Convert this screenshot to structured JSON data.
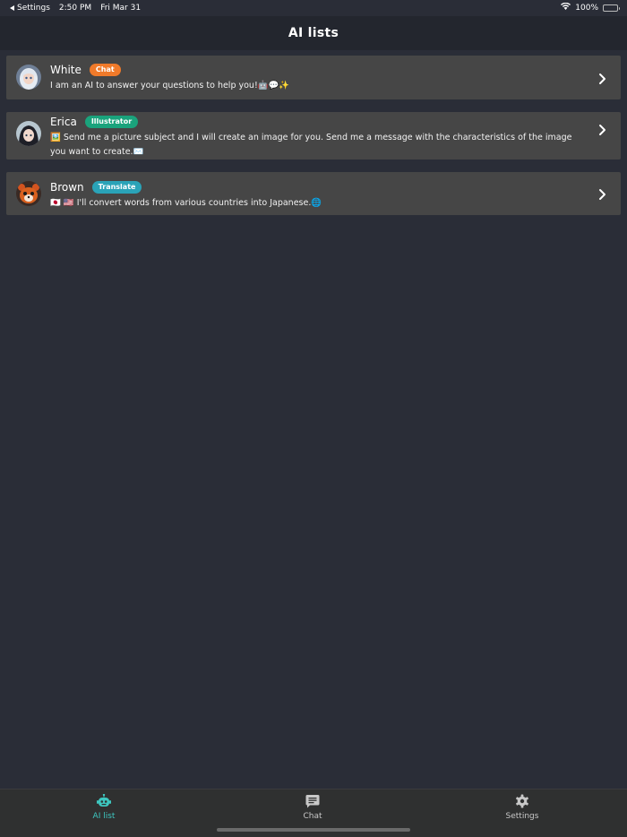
{
  "status_bar": {
    "back_label": "Settings",
    "time": "2:50 PM",
    "date": "Fri Mar 31",
    "battery": "100%"
  },
  "header": {
    "title": "AI lists"
  },
  "ai_list": [
    {
      "name": "White",
      "badge": "Chat",
      "badge_color": "#f07a2a",
      "description": "I am an AI to answer your questions to help you!🤖💬✨"
    },
    {
      "name": "Erica",
      "badge": "Illustrator",
      "badge_color": "#1aa37c",
      "description": "🖼️ Send me a picture subject and I will create an image for you. Send me a message with the characteristics of the image you want to create.✉️"
    },
    {
      "name": "Brown",
      "badge": "Translate",
      "badge_color": "#2aa3b8",
      "description": "🇯🇵 🇺🇸 I'll convert words from various countries into Japanese.🌐"
    }
  ],
  "tabs": [
    {
      "label": "AI list",
      "icon": "robot-icon",
      "active": true
    },
    {
      "label": "Chat",
      "icon": "chat-bubble-icon",
      "active": false
    },
    {
      "label": "Settings",
      "icon": "gear-icon",
      "active": false
    }
  ],
  "colors": {
    "background": "#2a2d37",
    "header": "#23262e",
    "card": "#464646",
    "tab_active": "#3ec7c0",
    "tab_inactive": "#c8c8c8"
  }
}
